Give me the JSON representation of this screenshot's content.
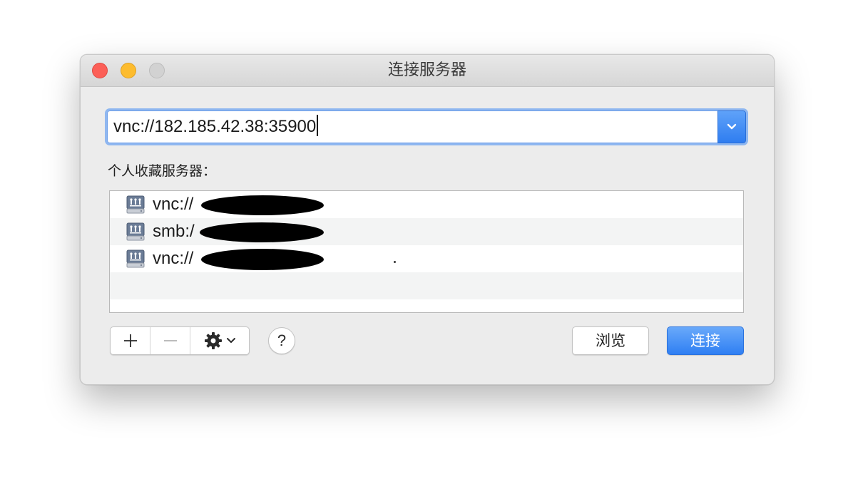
{
  "window": {
    "title": "连接服务器"
  },
  "address": {
    "value": "vnc://182.185.42.38:35900"
  },
  "favorites": {
    "label": "个人收藏服务器：",
    "items": [
      {
        "prefix": "vnc://"
      },
      {
        "prefix": "smb:/"
      },
      {
        "prefix": "vnc://"
      }
    ]
  },
  "buttons": {
    "browse": "浏览",
    "connect": "连接",
    "help": "?"
  },
  "icons": {
    "dropdown": "chevron-down-icon",
    "add": "plus-icon",
    "remove": "minus-icon",
    "action": "gear-icon",
    "server": "network-drive-icon"
  },
  "colors": {
    "accent": "#2f7ff3",
    "focus_ring": "#8fb7f0",
    "close": "#fc5f57",
    "minimize": "#fdbc2e",
    "zoom": "#d2d2d2"
  }
}
